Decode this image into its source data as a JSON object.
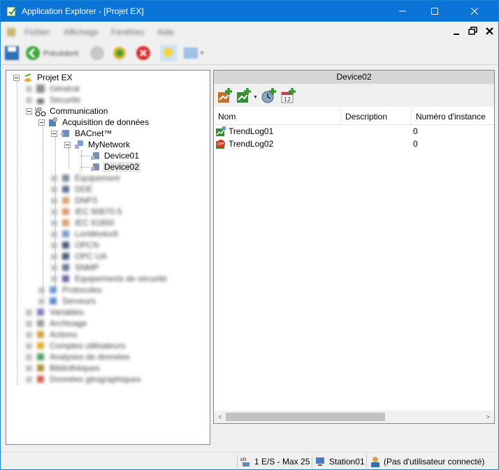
{
  "window": {
    "title": "Application Explorer - [Projet EX]",
    "titlebar_color": "#0a74d6"
  },
  "menubar": {
    "items": [
      "Fichier",
      "Affichage",
      "Fenêtres",
      "Aide"
    ]
  },
  "toolbar": {
    "back_label": "Précédent"
  },
  "tree": {
    "root": "Projet EX",
    "general": "Général",
    "securite": "Sécurité",
    "communication": "Communication",
    "acquisition": "Acquisition de données",
    "bacnet": "BACnet™",
    "mynetwork": "MyNetwork",
    "device01": "Device01",
    "device02": "Device02",
    "blurred_items": [
      "Équipement",
      "DDE",
      "DNP3",
      "IEC 60870-5",
      "IEC 61850",
      "LonWorks®",
      "OPCN",
      "OPC UA",
      "SNMP",
      "Equipements de sécurité",
      "Protocoles",
      "Serveurs",
      "Variables",
      "Archivage",
      "Actions",
      "Comptes utilisateurs",
      "Analyses de données",
      "Bibliothèques",
      "Données géographiques"
    ]
  },
  "detail": {
    "header": "Device02",
    "columns": [
      "Nom",
      "Description",
      "Numéro d'instance"
    ],
    "rows": [
      {
        "name": "TrendLog01",
        "description": "",
        "instance": "0",
        "icon": "trendlog-icon"
      },
      {
        "name": "TrendLog02",
        "description": "",
        "instance": "0",
        "icon": "trendlog-off-icon"
      }
    ]
  },
  "statusbar": {
    "io": "1 E/S - Max 25",
    "station": "Station01",
    "user": "(Pas d'utilisateur connecté)"
  }
}
